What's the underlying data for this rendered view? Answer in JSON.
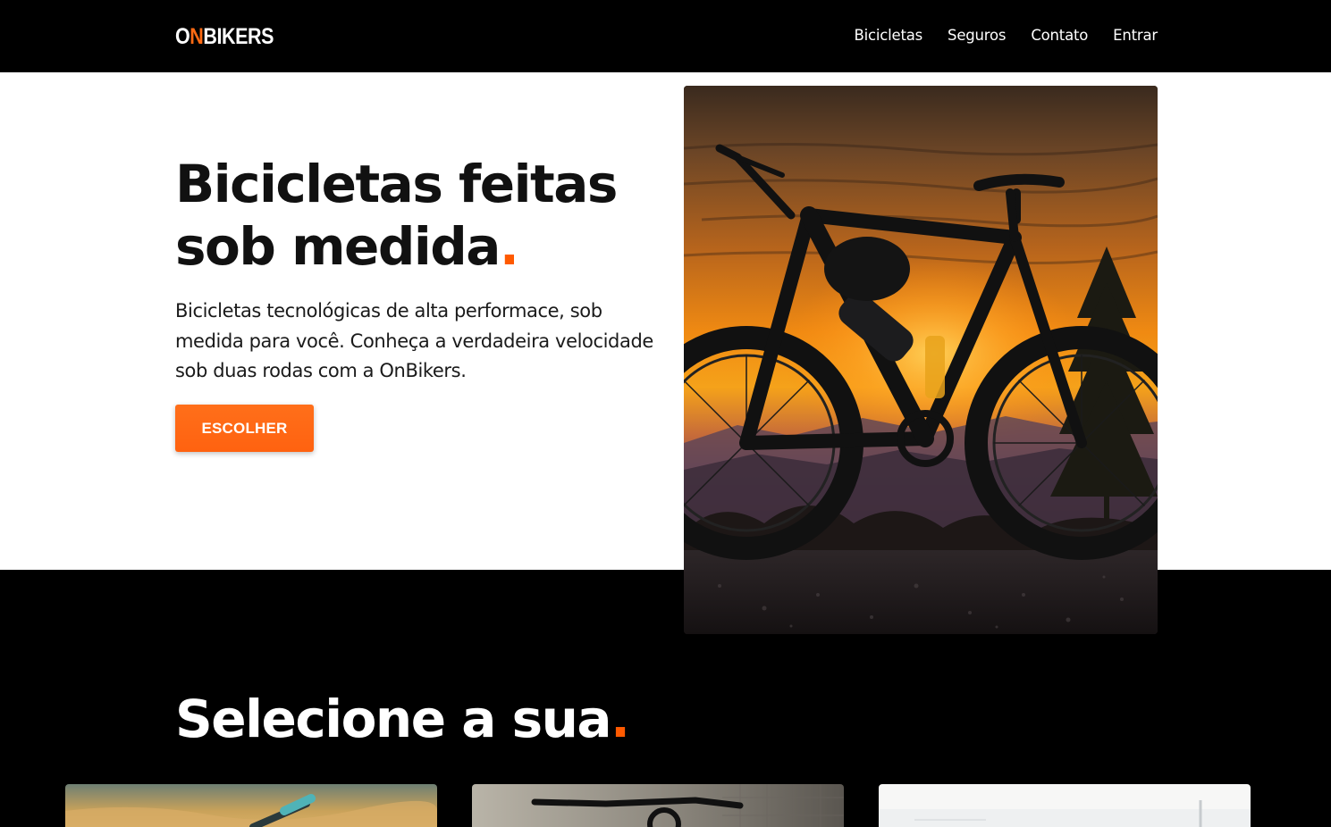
{
  "header": {
    "logo_part1": "O",
    "logo_accent": "N",
    "logo_part2": "BIKERS",
    "nav": [
      "Bicicletas",
      "Seguros",
      "Contato",
      "Entrar"
    ]
  },
  "hero": {
    "title_line1": "Bicicletas feitas",
    "title_line2": "sob medida",
    "title_dot": ".",
    "description": "Bicicletas tecnológicas de alta performace, sob medida para você. Conheça a verdadeira velocidade sob duas rodas com a OnBikers.",
    "cta_label": "ESCOLHER",
    "image_alt": "bike-at-sunset-photo"
  },
  "selection": {
    "title": "Selecione a sua",
    "title_dot": "."
  },
  "colors": {
    "accent": "#ff6a13",
    "background_dark": "#000000",
    "background_light": "#ffffff"
  }
}
